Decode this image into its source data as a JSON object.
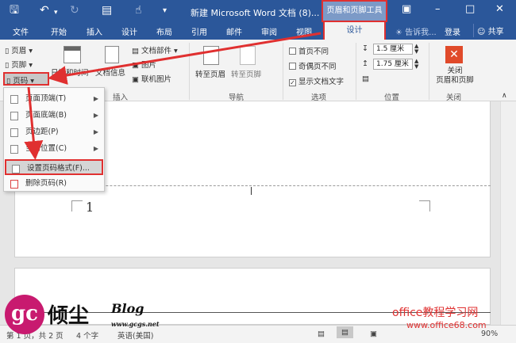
{
  "title_bar": {
    "doc_title": "新建 Microsoft Word 文档 (8)...",
    "context_group": "页眉和页脚工具",
    "quick_access": [
      "save-icon",
      "undo-icon",
      "redo-icon",
      "print-preview-icon",
      "touch-mode-icon",
      "customize-icon"
    ],
    "window_buttons": [
      "ribbon-display-icon",
      "minimize-icon",
      "restore-icon",
      "close-icon"
    ]
  },
  "tabs": [
    "文件",
    "开始",
    "插入",
    "设计",
    "布局",
    "引用",
    "邮件",
    "审阅",
    "视图"
  ],
  "context_tab": "设计",
  "tell_me": "告诉我...",
  "login": "登录",
  "share": "共享",
  "ribbon": {
    "header_label": "页眉",
    "footer_label": "页脚",
    "page_number_label": "页码",
    "date_time_label": "日期和时间",
    "doc_info_label": "文档信息",
    "doc_parts_label": "文档部件",
    "picture_label": "图片",
    "online_picture_label": "联机图片",
    "insert_group": "插入",
    "goto_header_label": "转至页眉",
    "goto_footer_label": "转至页脚",
    "nav_group": "导航",
    "diff_first_page": "首页不同",
    "diff_odd_even": "奇偶页不同",
    "show_doc_text": "显示文档文字",
    "options_group": "选项",
    "header_pos_value": "1.5 厘米",
    "footer_pos_value": "1.75 厘米",
    "position_group": "位置",
    "close_label": "关闭\n页眉和页脚",
    "close_line1": "关闭",
    "close_line2": "页眉和页脚",
    "close_group": "关闭"
  },
  "dropdown": {
    "items": [
      {
        "label": "页面顶端(T)",
        "submenu": true
      },
      {
        "label": "页面底端(B)",
        "submenu": true
      },
      {
        "label": "页边距(P)",
        "submenu": true
      },
      {
        "label": "当前位置(C)",
        "submenu": true
      },
      {
        "label": "设置页码格式(F)...",
        "submenu": false
      },
      {
        "label": "删除页码(R)",
        "submenu": false
      }
    ]
  },
  "document": {
    "page_number": "1"
  },
  "status_bar": {
    "page_info": "第 1 页，共 2 页",
    "word_count": "4 个字",
    "language": "英语(美国)",
    "zoom": "90%"
  },
  "watermark": {
    "logo_text": "gc",
    "name": "倾尘",
    "blog": "Blog",
    "url": "www.gcgs.net",
    "cn_site": "office教程学习网",
    "site": "www.office68.com"
  },
  "colors": {
    "ribbon_blue": "#2b579a",
    "highlight_red": "#e03030",
    "close_red": "#e04a2a"
  }
}
